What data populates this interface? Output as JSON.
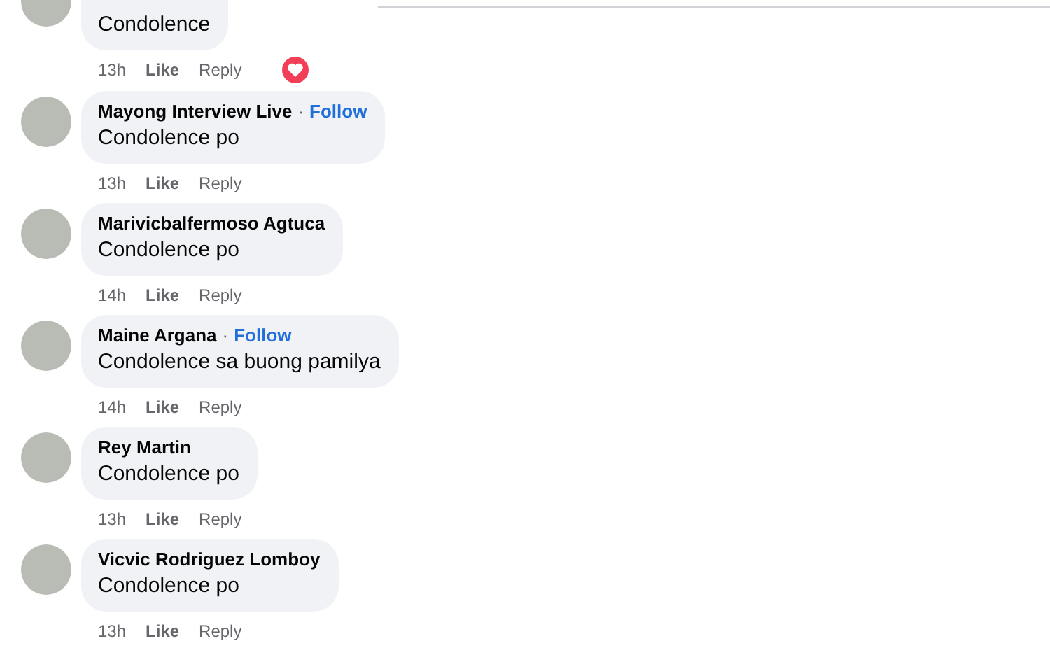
{
  "comments": [
    {
      "text": "Condolence",
      "time": "13h",
      "like": "Like",
      "reply": "Reply",
      "reacted": true
    },
    {
      "author": "Mayong Interview Live",
      "separator": "·",
      "follow": "Follow",
      "text": "Condolence po",
      "time": "13h",
      "like": "Like",
      "reply": "Reply",
      "reacted": false
    },
    {
      "author": "Marivicbalfermoso Agtuca",
      "text": "Condolence po",
      "time": "14h",
      "like": "Like",
      "reply": "Reply",
      "reacted": false
    },
    {
      "author": "Maine Argana",
      "separator": "·",
      "follow": "Follow",
      "text": "Condolence sa buong pamilya",
      "time": "14h",
      "like": "Like",
      "reply": "Reply",
      "reacted": false
    },
    {
      "author": "Rey Martin",
      "text": "Condolence po",
      "time": "13h",
      "like": "Like",
      "reply": "Reply",
      "reacted": false
    },
    {
      "author": "Vicvic Rodriguez Lomboy",
      "text": "Condolence po",
      "time": "13h",
      "like": "Like",
      "reply": "Reply",
      "reacted": false
    }
  ]
}
